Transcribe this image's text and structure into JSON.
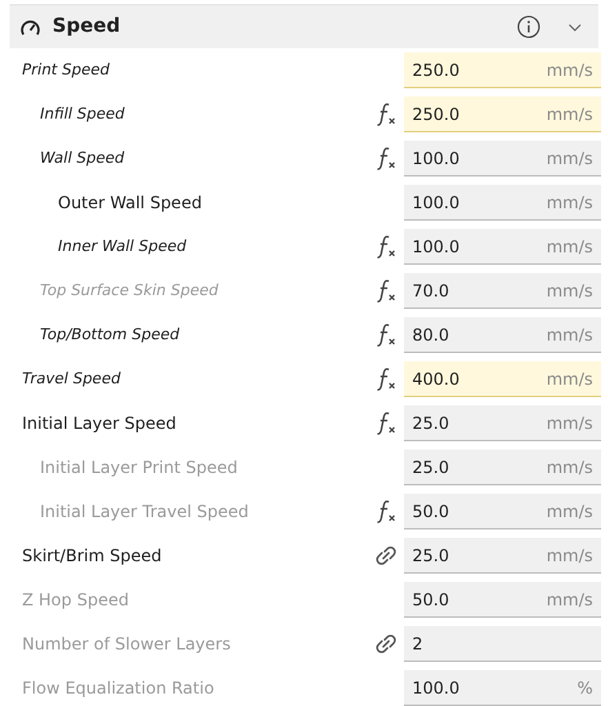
{
  "section": {
    "title": "Speed",
    "expanded": true
  },
  "settings": [
    {
      "label": "Print Speed",
      "value": "250.0",
      "unit": "mm/s",
      "modified": true,
      "enabled": true,
      "highlighted": true,
      "kind": "plain",
      "children": [
        {
          "label": "Infill Speed",
          "value": "250.0",
          "unit": "mm/s",
          "modified": true,
          "enabled": true,
          "highlighted": true,
          "kind": "formula"
        },
        {
          "label": "Wall Speed",
          "value": "100.0",
          "unit": "mm/s",
          "modified": true,
          "enabled": true,
          "highlighted": false,
          "kind": "formula",
          "children": [
            {
              "label": "Outer Wall Speed",
              "value": "100.0",
              "unit": "mm/s",
              "modified": false,
              "enabled": true,
              "highlighted": false,
              "kind": "plain"
            },
            {
              "label": "Inner Wall Speed",
              "value": "100.0",
              "unit": "mm/s",
              "modified": true,
              "enabled": true,
              "highlighted": false,
              "kind": "formula"
            }
          ]
        },
        {
          "label": "Top Surface Skin Speed",
          "value": "70.0",
          "unit": "mm/s",
          "modified": true,
          "enabled": false,
          "highlighted": false,
          "kind": "formula"
        },
        {
          "label": "Top/Bottom Speed",
          "value": "80.0",
          "unit": "mm/s",
          "modified": true,
          "enabled": true,
          "highlighted": false,
          "kind": "formula"
        }
      ]
    },
    {
      "label": "Travel Speed",
      "value": "400.0",
      "unit": "mm/s",
      "modified": true,
      "enabled": true,
      "highlighted": true,
      "kind": "formula"
    },
    {
      "label": "Initial Layer Speed",
      "value": "25.0",
      "unit": "mm/s",
      "modified": false,
      "enabled": true,
      "highlighted": false,
      "kind": "formula",
      "children": [
        {
          "label": "Initial Layer Print Speed",
          "value": "25.0",
          "unit": "mm/s",
          "modified": false,
          "enabled": false,
          "highlighted": false,
          "kind": "plain"
        },
        {
          "label": "Initial Layer Travel Speed",
          "value": "50.0",
          "unit": "mm/s",
          "modified": false,
          "enabled": false,
          "highlighted": false,
          "kind": "formula"
        }
      ]
    },
    {
      "label": "Skirt/Brim Speed",
      "value": "25.0",
      "unit": "mm/s",
      "modified": false,
      "enabled": true,
      "highlighted": false,
      "kind": "linked"
    },
    {
      "label": "Z Hop Speed",
      "value": "50.0",
      "unit": "mm/s",
      "modified": false,
      "enabled": false,
      "highlighted": false,
      "kind": "plain"
    },
    {
      "label": "Number of Slower Layers",
      "value": "2",
      "modified": false,
      "enabled": false,
      "highlighted": false,
      "kind": "linked"
    },
    {
      "label": "Flow Equalization Ratio",
      "value": "100.0",
      "unit": "%",
      "modified": false,
      "enabled": false,
      "highlighted": false,
      "kind": "plain"
    }
  ]
}
